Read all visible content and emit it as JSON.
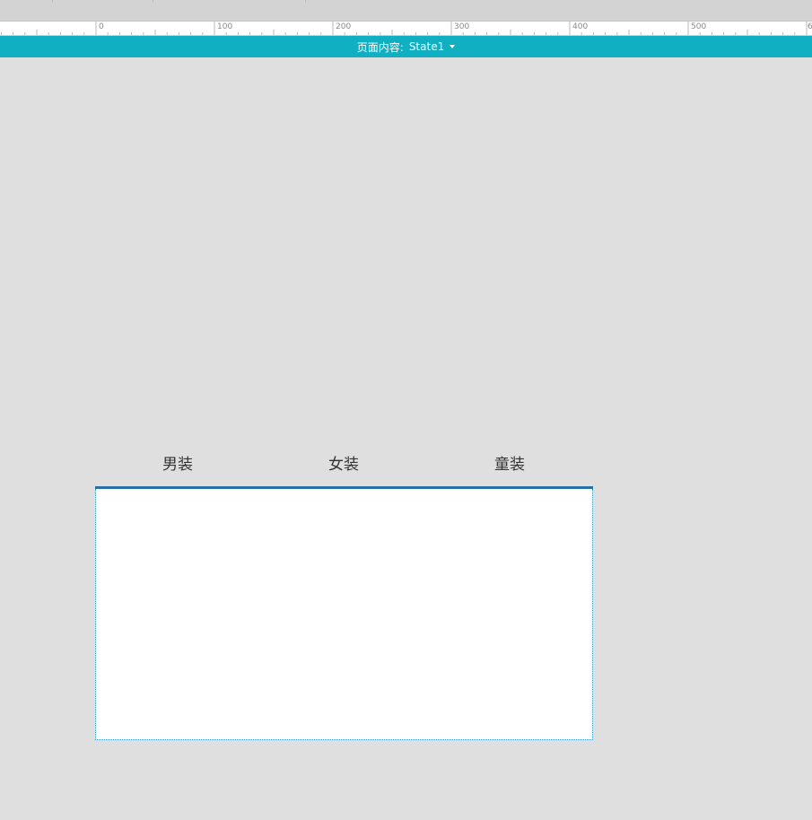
{
  "ruler": {
    "labels": [
      "0",
      "100",
      "200",
      "300",
      "400",
      "500",
      "6"
    ]
  },
  "state_bar": {
    "label": "页面内容:",
    "state_value": "State1",
    "background": "#11afc2"
  },
  "tabs": {
    "items": [
      {
        "label": "男装"
      },
      {
        "label": "女装"
      },
      {
        "label": "童装"
      }
    ],
    "underline_color": "#2b6fa6"
  },
  "icons": {
    "state_dropdown": "caret-down-icon"
  }
}
